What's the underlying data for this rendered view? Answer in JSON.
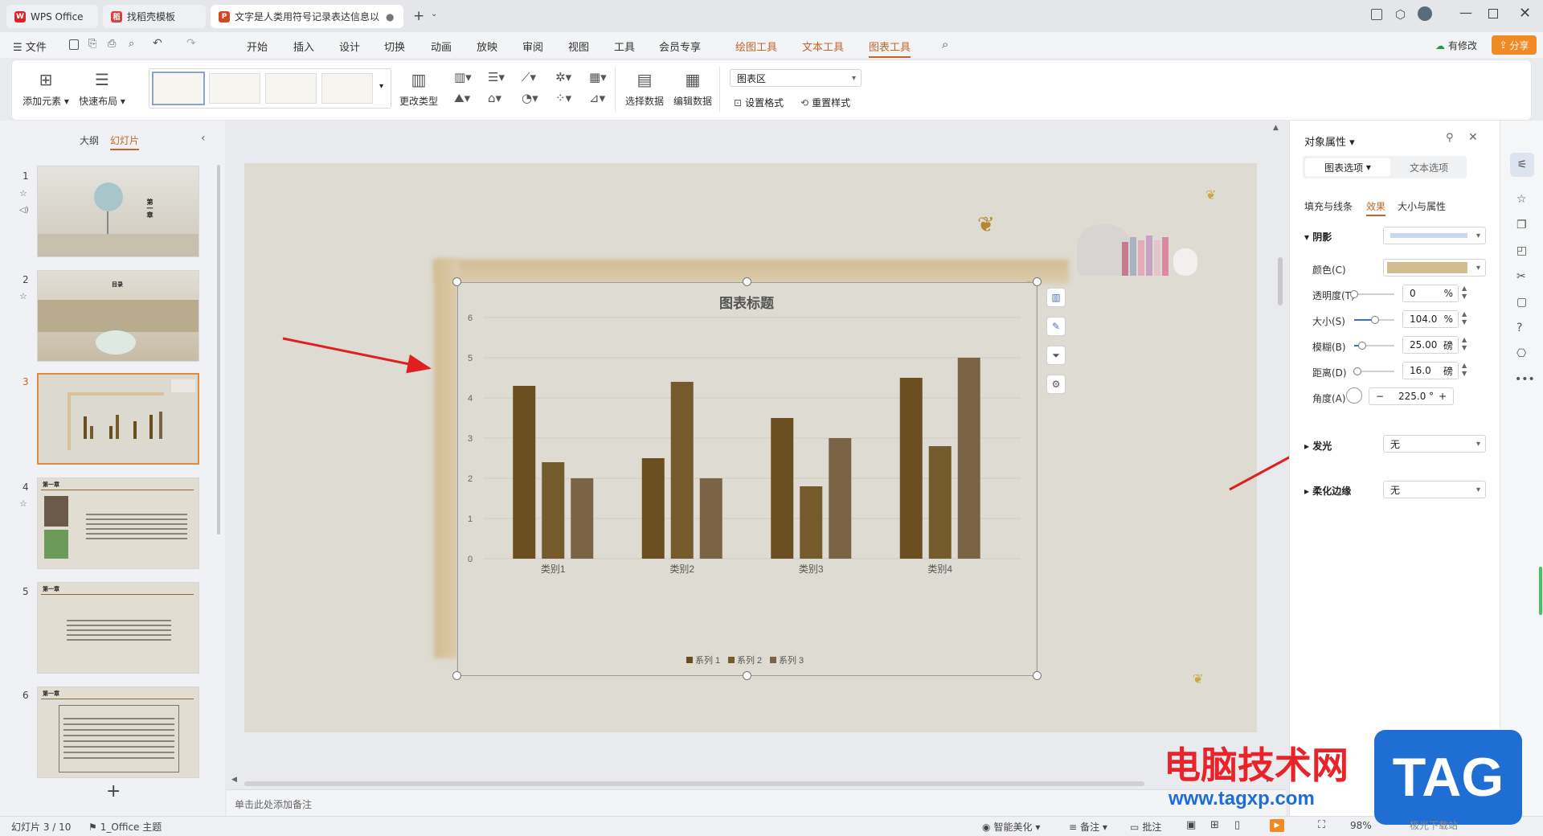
{
  "tabs": [
    {
      "label": "WPS Office",
      "color": "#d7262b"
    },
    {
      "label": "找稻壳模板",
      "color": "#e23b3b"
    },
    {
      "label": "文字是人类用符号记录表达信息以",
      "color": "#d24726"
    }
  ],
  "menu": {
    "file": "文件",
    "items": [
      "开始",
      "插入",
      "设计",
      "切换",
      "动画",
      "放映",
      "审阅",
      "视图",
      "工具",
      "会员专享"
    ],
    "tool_items": [
      "绘图工具",
      "文本工具",
      "图表工具"
    ],
    "has_change": "有修改",
    "share": "分享"
  },
  "ribbon": {
    "add_element": "添加元素",
    "quick_layout": "快速布局",
    "change_type": "更改类型",
    "select_data": "选择数据",
    "edit_data": "编辑数据",
    "area_select": "图表区",
    "set_format": "设置格式",
    "reset_style": "重置样式"
  },
  "left": {
    "outline": "大纲",
    "slides": "幻灯片",
    "nums": [
      "1",
      "2",
      "3",
      "4",
      "5",
      "6"
    ],
    "add": "+",
    "s1_text": "第一章",
    "s2_text": "目录",
    "s4_title": "第一章",
    "s5_title": "第一章",
    "s6_title": "第一章"
  },
  "notes": {
    "placeholder": "单击此处添加备注"
  },
  "chart_data": {
    "type": "bar",
    "title": "图表标题",
    "categories": [
      "类别1",
      "类别2",
      "类别3",
      "类别4"
    ],
    "series": [
      {
        "name": "系列 1",
        "values": [
          4.3,
          2.5,
          3.5,
          4.5
        ]
      },
      {
        "name": "系列 2",
        "values": [
          2.4,
          4.4,
          1.8,
          2.8
        ]
      },
      {
        "name": "系列 3",
        "values": [
          2,
          2,
          3,
          5
        ]
      }
    ],
    "yticks": [
      "0",
      "1",
      "2",
      "3",
      "4",
      "5",
      "6"
    ],
    "ylim": [
      0,
      6
    ],
    "grid": true,
    "legend": "bottom",
    "colors": [
      "#6b4e1f",
      "#755a2c",
      "#7b6446"
    ]
  },
  "right": {
    "title": "对象属性",
    "tab_chart": "图表选项",
    "tab_text": "文本选项",
    "subtabs": [
      "填充与线条",
      "效果",
      "大小与属性"
    ],
    "shadow": "阴影",
    "color": "颜色(C)",
    "color_value": "#d2bc91",
    "transparency": "透明度(T)",
    "transparency_val": "0",
    "transparency_unit": "%",
    "transparency_level": 0,
    "size": "大小(S)",
    "size_val": "104.0",
    "size_unit": "%",
    "size_level": 0.52,
    "blur": "模糊(B)",
    "blur_val": "25.00",
    "blur_unit": "磅",
    "blur_level": 0.2,
    "distance": "距离(D)",
    "distance_val": "16.0",
    "distance_unit": "磅",
    "distance_level": 0.08,
    "angle": "角度(A)",
    "angle_val": "225.0",
    "angle_unit": "°",
    "glow": "发光",
    "glow_val": "无",
    "soft": "柔化边缘",
    "soft_val": "无"
  },
  "status": {
    "slide_info": "幻灯片 3 / 10",
    "theme": "1_Office 主题",
    "beautify": "智能美化",
    "notes": "备注",
    "comment": "批注",
    "zoom": "98%"
  },
  "watermark": {
    "cn": "电脑技术网",
    "url": "www.tagxp.com",
    "tag": "TAG",
    "sub": "极光下载站"
  }
}
